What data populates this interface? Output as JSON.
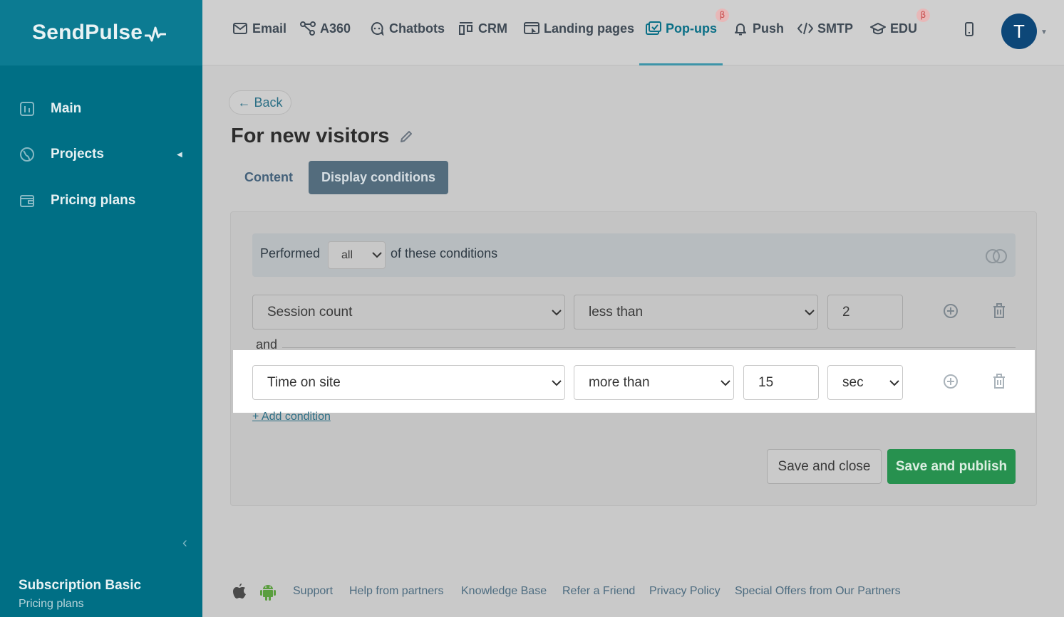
{
  "sidebar": {
    "logo": "SendPulse",
    "items": [
      {
        "label": "Main",
        "icon": "dashboard-icon"
      },
      {
        "label": "Projects",
        "icon": "globe-icon"
      },
      {
        "label": "Pricing plans",
        "icon": "wallet-icon"
      }
    ],
    "subscription": {
      "title": "Subscription Basic",
      "link": "Pricing plans"
    }
  },
  "topnav": {
    "items": [
      {
        "label": "Email",
        "icon": "mail-icon"
      },
      {
        "label": "A360",
        "icon": "nodes-icon"
      },
      {
        "label": "Chatbots",
        "icon": "chat-icon"
      },
      {
        "label": "CRM",
        "icon": "kanban-icon"
      },
      {
        "label": "Landing pages",
        "icon": "landing-icon"
      },
      {
        "label": "Pop-ups",
        "icon": "popup-icon",
        "active": true,
        "beta": "β"
      },
      {
        "label": "Push",
        "icon": "bell-icon"
      },
      {
        "label": "SMTP",
        "icon": "code-icon"
      },
      {
        "label": "EDU",
        "icon": "graduation-cap-icon",
        "beta": "β"
      }
    ],
    "avatar_initial": "T"
  },
  "page": {
    "back": "← Back",
    "title": "For new visitors",
    "tabs": [
      {
        "label": "Content",
        "active": false
      },
      {
        "label": "Display conditions",
        "active": true
      }
    ]
  },
  "conditions": {
    "performed_label": "Performed",
    "performed_value": "all",
    "suffix_label": "of these conditions",
    "rows": [
      {
        "field": "Session count",
        "operator": "less than",
        "value": "2"
      },
      {
        "field": "Time on site",
        "operator": "more than",
        "value": "15",
        "unit": "sec"
      }
    ],
    "joiner": "and",
    "add_condition": "+ Add condition"
  },
  "actions": {
    "save_close": "Save and close",
    "save_publish": "Save and publish"
  },
  "footer": {
    "links": [
      "Support",
      "Help from partners",
      "Knowledge Base",
      "Refer a Friend",
      "Privacy Policy",
      "Special Offers from Our Partners"
    ]
  },
  "colors": {
    "sidebar": "#006f85",
    "accent": "#0a6f86",
    "publish": "#27914f",
    "tab_active": "#536c7d"
  }
}
